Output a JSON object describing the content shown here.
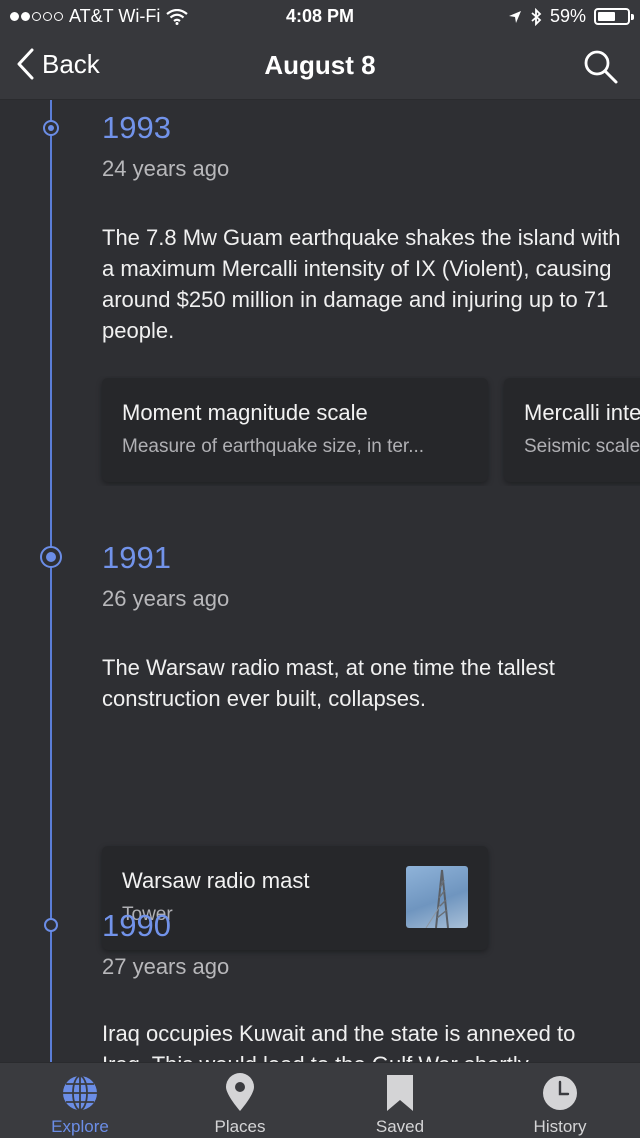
{
  "status_bar": {
    "carrier": "AT&T Wi-Fi",
    "time": "4:08 PM",
    "battery_text": "59%",
    "battery_level": 0.59,
    "signal_bars_filled": 2,
    "signal_bars_total": 5
  },
  "nav": {
    "back_label": "Back",
    "title": "August 8"
  },
  "events": [
    {
      "year": "1993",
      "ago": "24 years ago",
      "text": "The 7.8 Mw Guam earthquake shakes the island with a maximum Mercalli intensity of IX (Violent), causing around $250 million in damage and injuring up to 71 people.",
      "cards": [
        {
          "title": "Moment magnitude scale",
          "subtitle": "Measure of earthquake size, in ter..."
        },
        {
          "title": "Mercalli intensity scale",
          "subtitle": "Seismic scale"
        }
      ]
    },
    {
      "year": "1991",
      "ago": "26 years ago",
      "text": "The Warsaw radio mast, at one time the tallest construction ever built, collapses.",
      "cards": [
        {
          "title": "Warsaw radio mast",
          "subtitle": "Tower"
        }
      ]
    },
    {
      "year": "1990",
      "ago": "27 years ago",
      "text": "Iraq occupies Kuwait and the state is annexed to Iraq. This would lead to the Gulf War shortly"
    }
  ],
  "tabs": [
    {
      "label": "Explore",
      "icon": "globe-icon",
      "active": true
    },
    {
      "label": "Places",
      "icon": "map-pin-icon",
      "active": false
    },
    {
      "label": "Saved",
      "icon": "bookmark-icon",
      "active": false
    },
    {
      "label": "History",
      "icon": "clock-icon",
      "active": false
    }
  ],
  "colors": {
    "accent": "#6b8de6",
    "background": "#2e2f33",
    "card": "#26272a",
    "bar": "#37383c"
  }
}
